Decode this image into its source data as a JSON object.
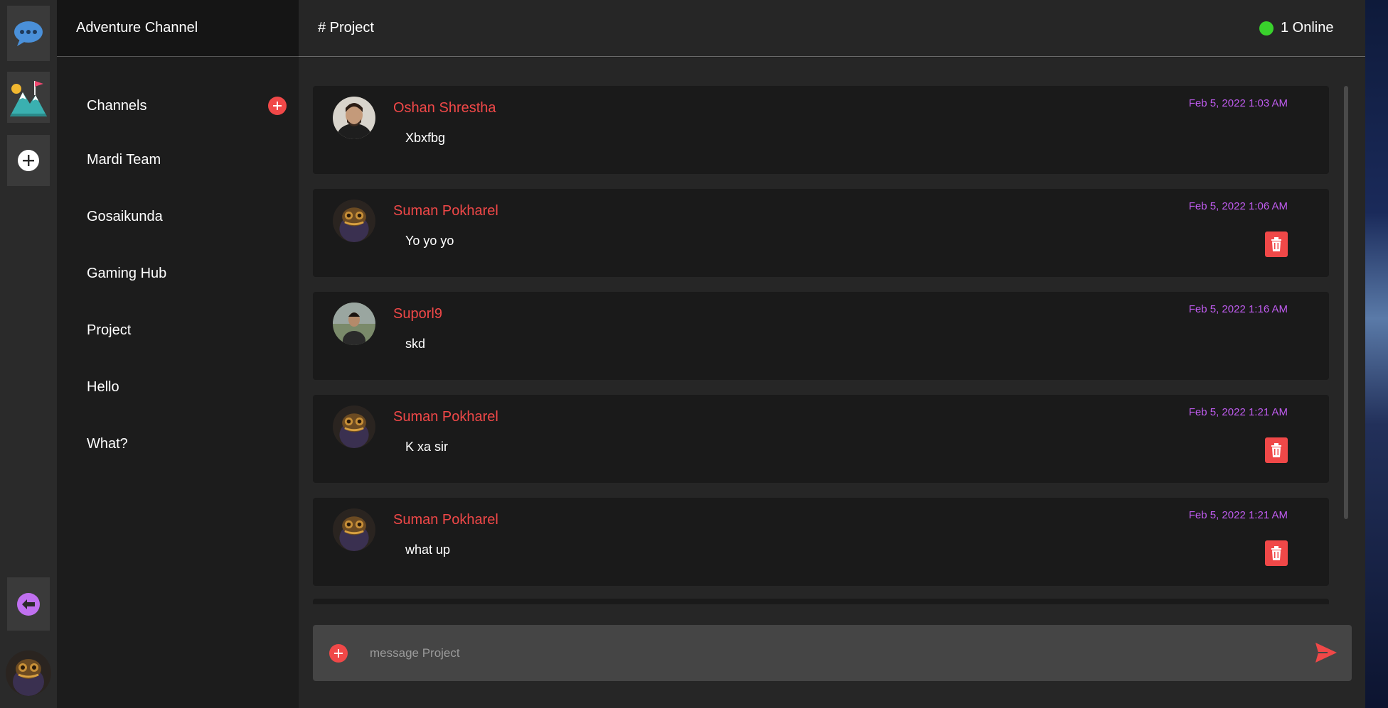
{
  "server": {
    "name": "Adventure Channel"
  },
  "channels_header": {
    "label": "Channels"
  },
  "channels": [
    {
      "label": "Mardi Team"
    },
    {
      "label": "Gosaikunda"
    },
    {
      "label": "Gaming Hub"
    },
    {
      "label": "Project"
    },
    {
      "label": "Hello"
    },
    {
      "label": "What?"
    }
  ],
  "topbar": {
    "channel_title": "# Project",
    "online_text": "1 Online"
  },
  "messages": [
    {
      "author": "Oshan Shrestha",
      "time": "Feb 5, 2022 1:03 AM",
      "text": "Xbxfbg",
      "deletable": false
    },
    {
      "author": "Suman Pokharel",
      "time": "Feb 5, 2022 1:06 AM",
      "text": "Yo yo yo",
      "deletable": true
    },
    {
      "author": "Suporl9",
      "time": "Feb 5, 2022 1:16 AM",
      "text": "skd",
      "deletable": false
    },
    {
      "author": "Suman Pokharel",
      "time": "Feb 5, 2022 1:21 AM",
      "text": "K xa sir",
      "deletable": true
    },
    {
      "author": "Suman Pokharel",
      "time": "Feb 5, 2022 1:21 AM",
      "text": "what up",
      "deletable": true
    }
  ],
  "composer": {
    "placeholder": "message Project"
  },
  "icons": {
    "rail": [
      "chat-bubble-icon",
      "mountain-flag-icon",
      "add-server-icon",
      "logout-icon"
    ],
    "add": "plus-icon",
    "delete": "trash-icon",
    "send": "send-icon"
  },
  "colors": {
    "accent": "#f04848",
    "timestamp": "#c05cf0",
    "online": "#39d12c",
    "background": "#262626"
  }
}
